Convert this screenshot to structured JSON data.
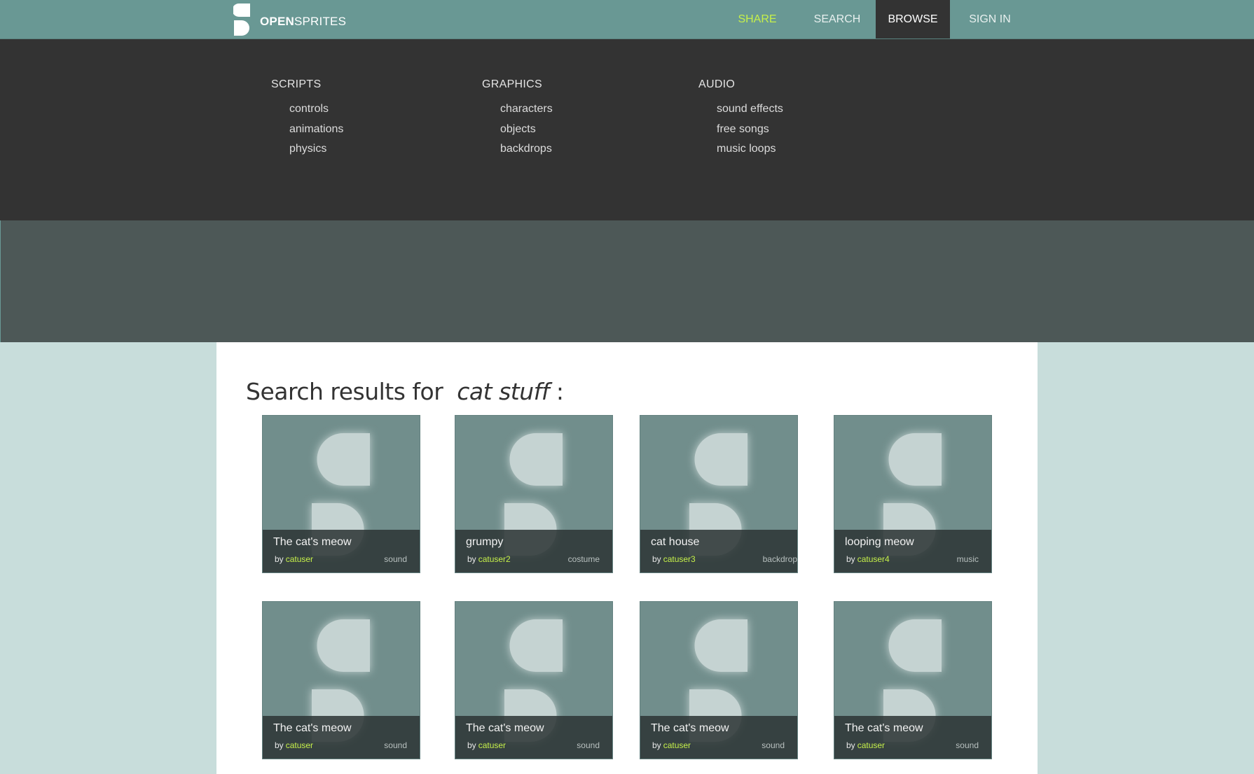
{
  "header": {
    "logo_open": "OPEN",
    "logo_sprites": "SPRITES",
    "nav": {
      "share": "SHARE",
      "search": "SEARCH",
      "browse": "BROWSE",
      "sign_in": "SIGN IN"
    }
  },
  "dropdown": {
    "columns": [
      {
        "heading": "SCRIPTS",
        "items": [
          "controls",
          "animations",
          "physics"
        ]
      },
      {
        "heading": "GRAPHICS",
        "items": [
          "characters",
          "objects",
          "backdrops"
        ]
      },
      {
        "heading": "AUDIO",
        "items": [
          "sound effects",
          "free songs",
          "music loops"
        ]
      }
    ]
  },
  "results": {
    "title_prefix": "Search results for",
    "query": "cat stuff",
    "title_suffix": ":",
    "by_label": "by",
    "cards": [
      {
        "title": "The cat's meow",
        "user": "catuser",
        "type": "sound"
      },
      {
        "title": "grumpy",
        "user": "catuser2",
        "type": "costume"
      },
      {
        "title": "cat house",
        "user": "catuser3",
        "type": "backdrop"
      },
      {
        "title": "looping meow",
        "user": "catuser4",
        "type": "music"
      },
      {
        "title": "The cat's meow",
        "user": "catuser",
        "type": "sound"
      },
      {
        "title": "The cat's meow",
        "user": "catuser",
        "type": "sound"
      },
      {
        "title": "The cat's meow",
        "user": "catuser",
        "type": "sound"
      },
      {
        "title": "The cat's meow",
        "user": "catuser",
        "type": "sound"
      }
    ]
  },
  "colors": {
    "header_bg": "#699894",
    "accent": "#c6f04a",
    "dropdown_bg": "#333333",
    "banner_bg": "#4d5857",
    "page_bg": "#c8dddb"
  },
  "icons": {
    "logo": "opensprites-s-logo-icon",
    "card_placeholder": "opensprites-s-placeholder-icon"
  }
}
